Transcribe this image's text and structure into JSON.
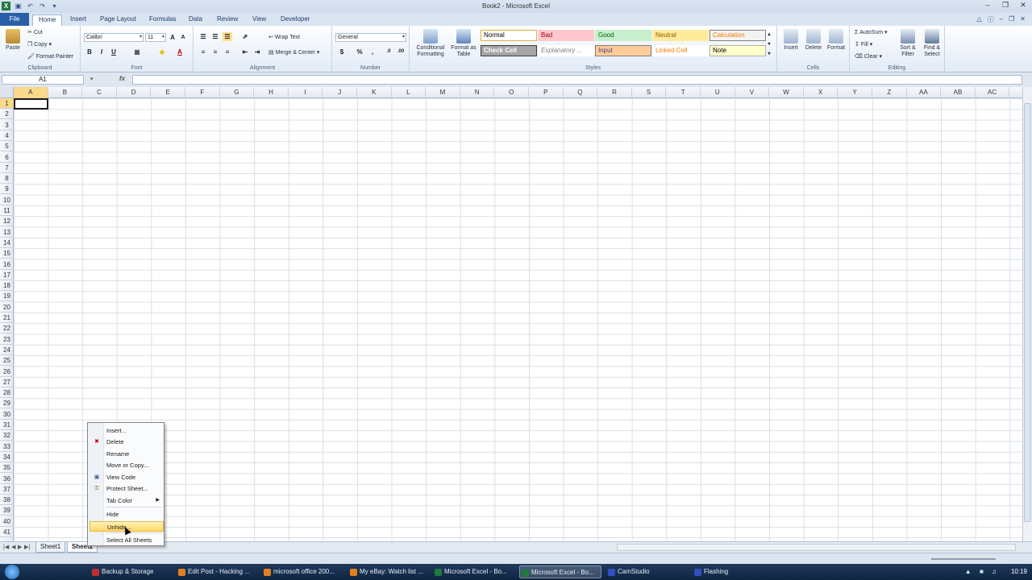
{
  "window": {
    "title": "Book2 - Microsoft Excel"
  },
  "tabs": [
    "File",
    "Home",
    "Insert",
    "Page Layout",
    "Formulas",
    "Data",
    "Review",
    "View",
    "Developer"
  ],
  "ribbon": {
    "clipboard": {
      "label": "Clipboard",
      "paste": "Paste",
      "cut": "Cut",
      "copy": "Copy",
      "format_painter": "Format Painter"
    },
    "font": {
      "label": "Font",
      "name": "Calibri",
      "size": "11",
      "bold": "B",
      "italic": "I",
      "underline": "U"
    },
    "alignment": {
      "label": "Alignment",
      "wrap": "Wrap Text",
      "merge": "Merge & Center"
    },
    "number": {
      "label": "Number",
      "format": "General"
    },
    "styles": {
      "label": "Styles",
      "conditional": "Conditional Formatting",
      "format_table": "Format as Table",
      "cells": [
        {
          "name": "Normal",
          "bg": "#ffffff",
          "fg": "#000000",
          "border": "#e0b040"
        },
        {
          "name": "Bad",
          "bg": "#ffc7ce",
          "fg": "#9c0006",
          "border": "#ffc7ce"
        },
        {
          "name": "Good",
          "bg": "#c6efce",
          "fg": "#006100",
          "border": "#c6efce"
        },
        {
          "name": "Neutral",
          "bg": "#ffeb9c",
          "fg": "#9c5700",
          "border": "#ffeb9c"
        },
        {
          "name": "Calculation",
          "bg": "#f2f2f2",
          "fg": "#fa7d00",
          "border": "#7f7f7f"
        },
        {
          "name": "Check Cell",
          "bg": "#a5a5a5",
          "fg": "#ffffff",
          "border": "#3f3f3f"
        },
        {
          "name": "Explanatory ...",
          "bg": "#ffffff",
          "fg": "#7f7f7f",
          "border": "#ffffff"
        },
        {
          "name": "Input",
          "bg": "#ffcc99",
          "fg": "#3f3f76",
          "border": "#7f7f7f"
        },
        {
          "name": "Linked Cell",
          "bg": "#ffffff",
          "fg": "#fa7d00",
          "border": "#ffffff"
        },
        {
          "name": "Note",
          "bg": "#ffffcc",
          "fg": "#000000",
          "border": "#b2b2b2"
        }
      ]
    },
    "cells": {
      "label": "Cells",
      "insert": "Insert",
      "delete": "Delete",
      "format": "Format"
    },
    "editing": {
      "label": "Editing",
      "autosum": "AutoSum",
      "fill": "Fill",
      "clear": "Clear",
      "sort": "Sort & Filter",
      "find": "Find & Select"
    }
  },
  "formula_bar": {
    "name_box": "A1",
    "fx": "fx",
    "value": ""
  },
  "columns": [
    "A",
    "B",
    "C",
    "D",
    "E",
    "F",
    "G",
    "H",
    "I",
    "J",
    "K",
    "L",
    "M",
    "N",
    "O",
    "P",
    "Q",
    "R",
    "S",
    "T",
    "U",
    "V",
    "W",
    "X",
    "Y",
    "Z",
    "AA",
    "AB",
    "AC"
  ],
  "rows": [
    "1",
    "2",
    "3",
    "4",
    "5",
    "6",
    "7",
    "8",
    "9",
    "10",
    "11",
    "12",
    "13",
    "14",
    "15",
    "16",
    "17",
    "18",
    "19",
    "20",
    "21",
    "22",
    "23",
    "24",
    "25",
    "26",
    "27",
    "28",
    "29",
    "30",
    "31",
    "32",
    "33",
    "34",
    "35",
    "36",
    "37",
    "38",
    "39",
    "40",
    "41"
  ],
  "sheets": [
    "Sheet1",
    "Sheet2"
  ],
  "context_menu": {
    "items": [
      {
        "label": "Insert...",
        "icon": ""
      },
      {
        "label": "Delete",
        "icon": "delete-icon"
      },
      {
        "label": "Rename",
        "icon": ""
      },
      {
        "label": "Move or Copy...",
        "icon": ""
      },
      {
        "label": "View Code",
        "icon": "view-code-icon"
      },
      {
        "label": "Protect Sheet...",
        "icon": "protect-sheet-icon"
      },
      {
        "label": "Tab Color",
        "icon": "",
        "submenu": true
      },
      {
        "label": "Hide",
        "icon": ""
      },
      {
        "label": "Unhide...",
        "icon": "",
        "highlighted": true
      },
      {
        "label": "Select All Sheets",
        "icon": ""
      }
    ]
  },
  "taskbar": {
    "buttons": [
      {
        "label": "Backup & Storage",
        "color": "#c03030"
      },
      {
        "label": "Edit Post - Hacking ...",
        "color": "#e08020"
      },
      {
        "label": "microsoft office 200...",
        "color": "#e08020"
      },
      {
        "label": "My eBay: Watch list ...",
        "color": "#e08020"
      },
      {
        "label": "Microsoft Excel - Bo...",
        "color": "#1f7a3e"
      },
      {
        "label": "Microsoft Excel - Bo...",
        "color": "#1f7a3e",
        "active": true
      },
      {
        "label": "CamStudio",
        "color": "#3050c0"
      },
      {
        "label": "Flashing",
        "color": "#3050c0"
      }
    ],
    "clock": "10:19"
  }
}
